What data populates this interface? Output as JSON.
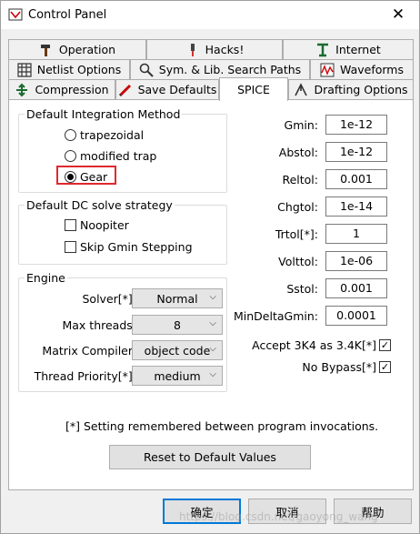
{
  "window": {
    "title": "Control Panel",
    "close_glyph": "✕"
  },
  "tabs": {
    "row1": [
      {
        "label": "Operation",
        "icon": "hammer-icon"
      },
      {
        "label": "Hacks!",
        "icon": "wrench-icon"
      },
      {
        "label": "Internet",
        "icon": "network-icon"
      }
    ],
    "row2": [
      {
        "label": "Netlist Options",
        "icon": "grid-icon"
      },
      {
        "label": "Sym. & Lib. Search Paths",
        "icon": "magnifier-icon"
      },
      {
        "label": "Waveforms",
        "icon": "waveform-icon"
      }
    ],
    "row3": [
      {
        "label": "Compression",
        "icon": "compress-icon"
      },
      {
        "label": "Save Defaults",
        "icon": "pencil-icon"
      },
      {
        "label": "SPICE",
        "icon": ""
      },
      {
        "label": "Drafting Options",
        "icon": "drafting-icon"
      }
    ]
  },
  "integration": {
    "title": "Default Integration Method",
    "options": [
      "trapezoidal",
      "modified trap",
      "Gear"
    ],
    "selected": "Gear"
  },
  "dc": {
    "title": "Default DC solve strategy",
    "options": [
      {
        "label": "Noopiter",
        "checked": false
      },
      {
        "label": "Skip Gmin Stepping",
        "checked": false
      }
    ]
  },
  "engine": {
    "title": "Engine",
    "rows": [
      {
        "label": "Solver[*]:",
        "value": "Normal"
      },
      {
        "label": "Max threads:",
        "value": "8"
      },
      {
        "label": "Matrix Compiler:",
        "value": "object code"
      },
      {
        "label": "Thread Priority[*]:",
        "value": "medium"
      }
    ]
  },
  "params": [
    {
      "label": "Gmin:",
      "value": "1e-12"
    },
    {
      "label": "Abstol:",
      "value": "1e-12"
    },
    {
      "label": "Reltol:",
      "value": "0.001"
    },
    {
      "label": "Chgtol:",
      "value": "1e-14"
    },
    {
      "label": "Trtol[*]:",
      "value": "1"
    },
    {
      "label": "Volttol:",
      "value": "1e-06"
    },
    {
      "label": "Sstol:",
      "value": "0.001"
    },
    {
      "label": "MinDeltaGmin:",
      "value": "0.0001"
    }
  ],
  "checks": [
    {
      "label": "Accept 3K4 as 3.4K[*]",
      "checked": true
    },
    {
      "label": "No Bypass[*]",
      "checked": true
    }
  ],
  "note": "[*] Setting remembered between program invocations.",
  "reset_label": "Reset to Default Values",
  "footer": {
    "ok": "确定",
    "cancel": "取消",
    "help": "帮助"
  },
  "watermark": "https://blog.csdn.net/gaoyong_wang",
  "colors": {
    "highlight": "#e0282e",
    "focus": "#0078d7"
  }
}
